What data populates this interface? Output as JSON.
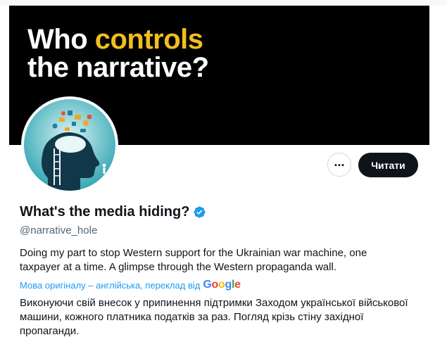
{
  "banner": {
    "line1_start": "Who ",
    "line1_highlight": "controls",
    "line2": "the narrative?",
    "highlight_color": "#f2be1e"
  },
  "profile": {
    "avatar_icon": "head-silhouette-with-media-icons",
    "display_name": "What's the media hiding?",
    "verified_icon": "verified-badge-icon",
    "handle": "@narrative_hole",
    "bio": "Doing my part to stop Western support for the Ukrainian war machine, one taxpayer at a time. A glimpse through the Western propaganda wall.",
    "translation_note": "Мова оригіналу – англійська, переклад від",
    "translation_provider": "Google",
    "bio_translated": "Виконуючи свій внесок у припинення підтримки Заходом української військової машини, кожного платника податків за раз. Погляд крізь стіну західної пропаганди."
  },
  "actions": {
    "more_label": "...",
    "follow_label": "Читати"
  },
  "colors": {
    "accent": "#1d9bf0",
    "button_dark": "#0f1419",
    "secondary_text": "#536471"
  }
}
